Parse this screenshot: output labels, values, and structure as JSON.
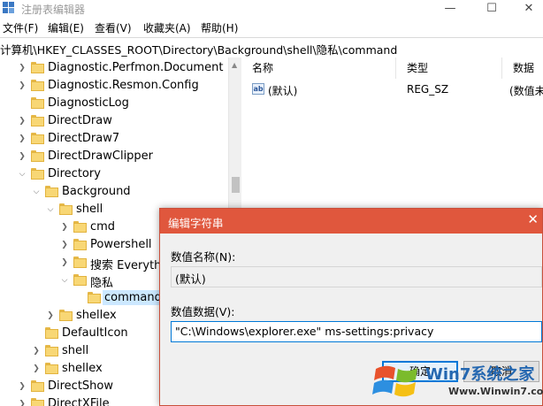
{
  "window": {
    "title": "注册表编辑器",
    "minimize": "—",
    "maximize": "☐",
    "close": "✕"
  },
  "menu": [
    "文件(F)",
    "编辑(E)",
    "查看(V)",
    "收藏夹(A)",
    "帮助(H)"
  ],
  "address": "计算机\\HKEY_CLASSES_ROOT\\Directory\\Background\\shell\\隐私\\command",
  "tree": [
    {
      "label": "Diagnostic.Perfmon.Document",
      "expander": "collapsed"
    },
    {
      "label": "Diagnostic.Resmon.Config",
      "expander": "collapsed"
    },
    {
      "label": "DiagnosticLog",
      "expander": "none"
    },
    {
      "label": "DirectDraw",
      "expander": "collapsed"
    },
    {
      "label": "DirectDraw7",
      "expander": "collapsed"
    },
    {
      "label": "DirectDrawClipper",
      "expander": "collapsed"
    },
    {
      "label": "Directory",
      "expander": "expanded"
    },
    {
      "label": "Background",
      "expander": "expanded"
    },
    {
      "label": "shell",
      "expander": "expanded"
    },
    {
      "label": "cmd",
      "expander": "collapsed"
    },
    {
      "label": "Powershell",
      "expander": "collapsed"
    },
    {
      "label": "搜索 Everything",
      "expander": "collapsed"
    },
    {
      "label": "隐私",
      "expander": "expanded"
    },
    {
      "label": "command",
      "expander": "none",
      "selected": true
    },
    {
      "label": "shellex",
      "expander": "collapsed"
    },
    {
      "label": "DefaultIcon",
      "expander": "none"
    },
    {
      "label": "shell",
      "expander": "collapsed"
    },
    {
      "label": "shellex",
      "expander": "collapsed"
    },
    {
      "label": "DirectShow",
      "expander": "collapsed"
    },
    {
      "label": "DirectXFile",
      "expander": "collapsed"
    }
  ],
  "list": {
    "headers": [
      "名称",
      "类型",
      "数据"
    ],
    "rows": [
      {
        "icon": "ab",
        "name": "(默认)",
        "type": "REG_SZ",
        "data": "(数值未"
      }
    ]
  },
  "dialog": {
    "title": "编辑字符串",
    "close": "✕",
    "name_label": "数值名称(N):",
    "name_value": "(默认)",
    "data_label": "数值数据(V):",
    "data_value": "\"C:\\Windows\\explorer.exe\" ms-settings:privacy",
    "ok": "确定",
    "cancel": "取消"
  },
  "watermark": {
    "text": "Win7系统之家",
    "url": "Www.Winwin7.com"
  },
  "colors": {
    "dialog_title": "#e0573d",
    "selection": "#cce8ff",
    "focus": "#0078d7",
    "folder": "#f8d775"
  }
}
